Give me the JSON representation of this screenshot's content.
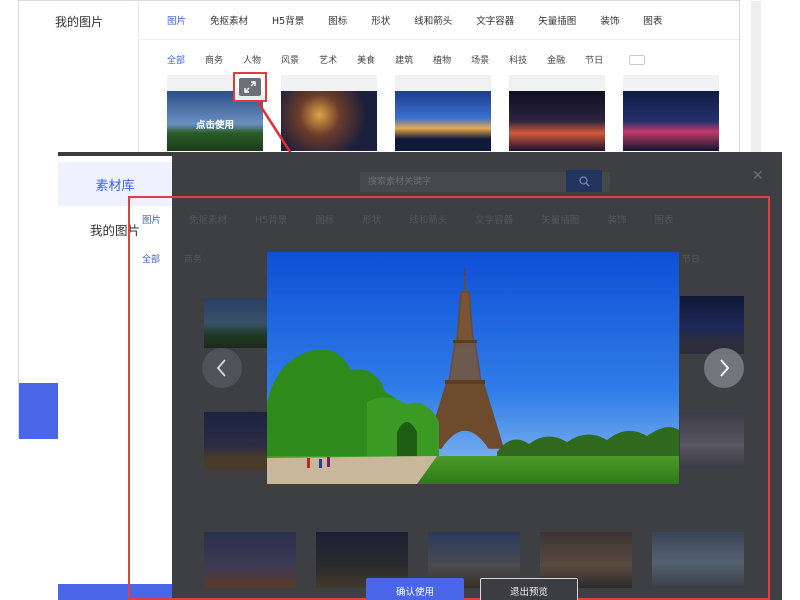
{
  "background_window": {
    "sidebar": {
      "my_images": "我的图片"
    },
    "tabs": [
      "图片",
      "免抠素材",
      "H5背景",
      "图标",
      "形状",
      "线和箭头",
      "文字容器",
      "矢量插图",
      "装饰",
      "图表"
    ],
    "subtabs": [
      "全部",
      "商务",
      "人物",
      "风景",
      "艺术",
      "美食",
      "建筑",
      "植物",
      "场景",
      "科技",
      "金融",
      "节日"
    ],
    "hover_caption": "点击使用"
  },
  "preview_window": {
    "sidebar": {
      "library": "素材库",
      "my_images": "我的图片"
    },
    "search_placeholder": "搜索素材关键字",
    "tabs": [
      "图片",
      "免抠素材",
      "H5背景",
      "图标",
      "形状",
      "线和箭头",
      "文字容器",
      "矢量插图",
      "装饰",
      "图表"
    ],
    "subtabs": [
      "全部",
      "商务"
    ],
    "subtab_right": "节日",
    "confirm_button": "确认使用",
    "exit_button": "退出预览"
  },
  "icons": {
    "expand": "expand-icon",
    "search": "search-icon",
    "close": "close-icon",
    "prev": "chevron-left-icon",
    "next": "chevron-right-icon"
  },
  "colors": {
    "accent": "#4a66e8",
    "highlight": "#e04040"
  }
}
